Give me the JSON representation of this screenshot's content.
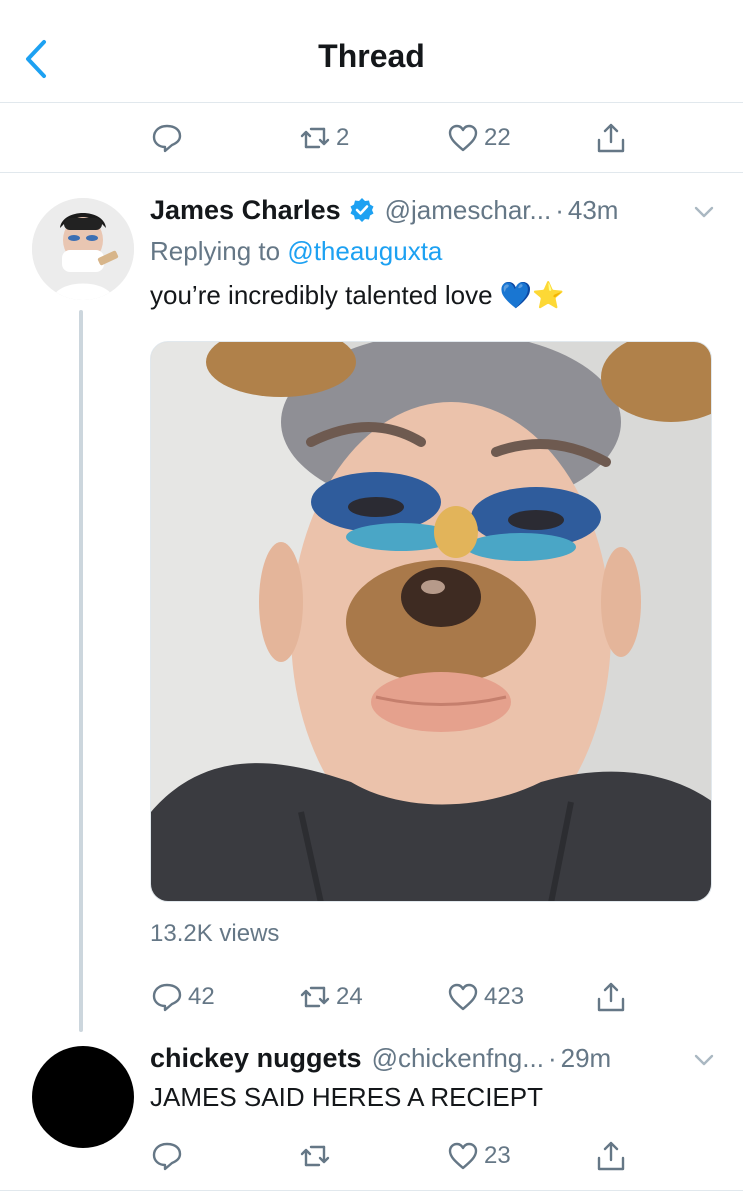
{
  "header": {
    "title": "Thread"
  },
  "top_actions": {
    "reply_count": "",
    "retweet_count": "2",
    "like_count": "22"
  },
  "tweet1": {
    "author_name": "James Charles",
    "handle": "@jameschar...",
    "separator": "·",
    "time": "43m",
    "replying_prefix": "Replying to",
    "replying_to": "@theauguxta",
    "text": "you’re incredibly talented love 💙⭐️",
    "views": "13.2K views",
    "reply_count": "42",
    "retweet_count": "24",
    "like_count": "423"
  },
  "tweet2": {
    "author_name": "chickey nuggets",
    "handle": "@chickenfng...",
    "separator": "·",
    "time": "29m",
    "text": "JAMES SAID HERES A RECIEPT",
    "reply_count": "",
    "retweet_count": "",
    "like_count": "23"
  },
  "icons": {
    "back": "chevron-left-icon",
    "reply": "reply-bubble-icon",
    "retweet": "retweet-icon",
    "like": "heart-icon",
    "share": "share-icon",
    "verified": "verified-badge-icon",
    "caret": "chevron-down-icon"
  },
  "colors": {
    "accent": "#1da1f2",
    "secondary_text": "#657786",
    "icon_gray": "#657786",
    "divider": "#e1e8ed"
  }
}
